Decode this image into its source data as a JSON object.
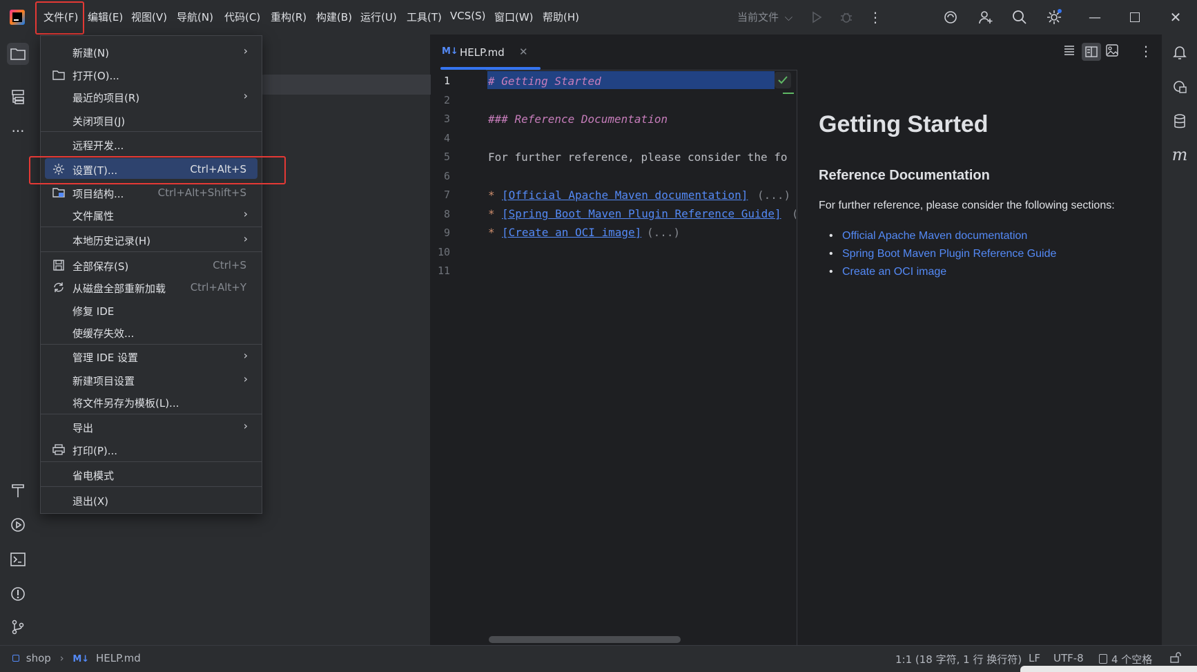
{
  "menubar": {
    "items": [
      "文件(F)",
      "编辑(E)",
      "视图(V)",
      "导航(N)",
      "代码(C)",
      "重构(R)",
      "构建(B)",
      "运行(U)",
      "工具(T)",
      "VCS(S)",
      "窗口(W)",
      "帮助(H)"
    ],
    "run_config": "当前文件"
  },
  "file_menu": {
    "new": "新建(N)",
    "open": "打开(O)...",
    "recent": "最近的项目(R)",
    "close_project": "关闭项目(J)",
    "remote_dev": "远程开发...",
    "settings": "设置(T)...",
    "settings_shortcut": "Ctrl+Alt+S",
    "project_structure": "项目结构...",
    "project_structure_shortcut": "Ctrl+Alt+Shift+S",
    "file_properties": "文件属性",
    "local_history": "本地历史记录(H)",
    "save_all": "全部保存(S)",
    "save_all_shortcut": "Ctrl+S",
    "reload_all": "从磁盘全部重新加载",
    "reload_all_shortcut": "Ctrl+Alt+Y",
    "repair_ide": "修复 IDE",
    "invalidate_caches": "使缓存失效...",
    "manage_ide_settings": "管理 IDE 设置",
    "new_project_settings": "新建项目设置",
    "save_as_template": "将文件另存为模板(L)...",
    "export": "导出",
    "print": "打印(P)...",
    "power_save": "省电模式",
    "exit": "退出(X)"
  },
  "editor": {
    "tab_icon": "M↓",
    "tab_name": "HELP.md",
    "line_numbers": [
      "1",
      "2",
      "3",
      "4",
      "5",
      "6",
      "7",
      "8",
      "9",
      "10",
      "11"
    ],
    "lines": {
      "l1": "# Getting Started",
      "l3": "### Reference Documentation",
      "l5": "For further reference, please consider the fo",
      "l7_bullet": "*",
      "l7_link": "[Official Apache Maven documentation]",
      "l7_fold": "(...)",
      "l8_bullet": "*",
      "l8_link": "[Spring Boot Maven Plugin Reference Guide]",
      "l8_fold": "(",
      "l9_bullet": "*",
      "l9_link": "[Create an OCI image]",
      "l9_fold": "(...)"
    }
  },
  "preview": {
    "h1": "Getting Started",
    "h3": "Reference Documentation",
    "para": "For further reference, please consider the following sections:",
    "links": [
      "Official Apache Maven documentation",
      "Spring Boot Maven Plugin Reference Guide",
      "Create an OCI image"
    ]
  },
  "statusbar": {
    "project": "shop",
    "file_icon": "M↓",
    "file": "HELP.md",
    "position": "1:1 (18 字符, 1 行 换行符)",
    "line_ending": "LF",
    "encoding": "UTF-8",
    "indent": "4 个空格"
  },
  "colors": {
    "accent": "#3574f0",
    "highlight_red": "#e53935",
    "selected_menu": "#2e436e",
    "link": "#548af7"
  }
}
